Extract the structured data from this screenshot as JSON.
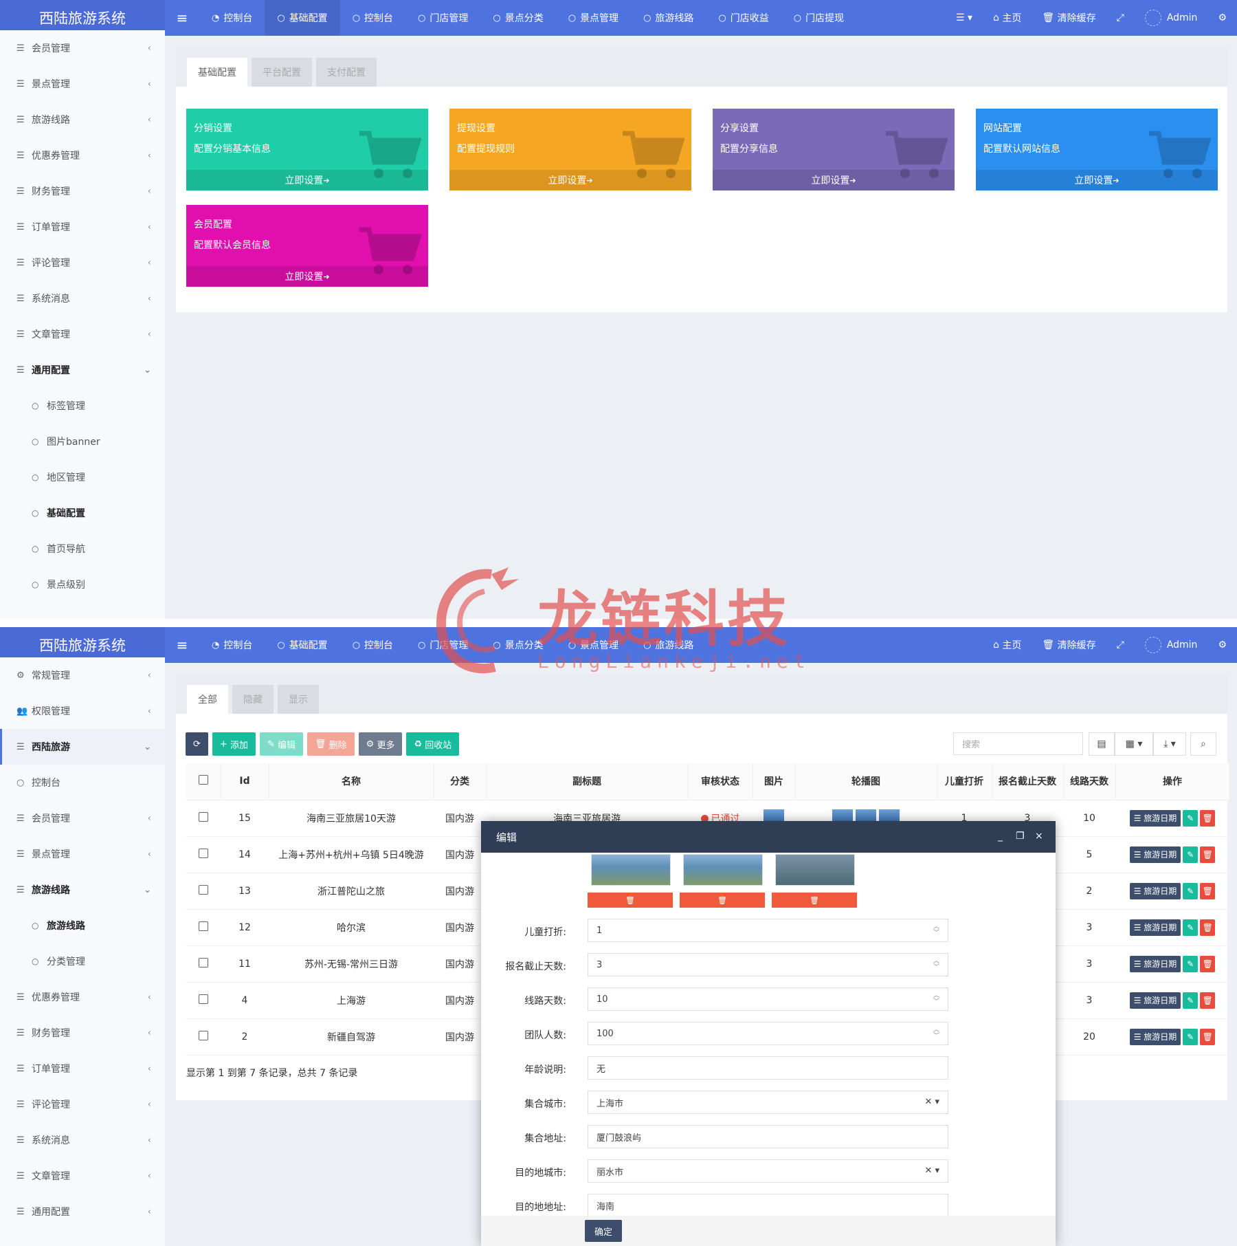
{
  "panel1": {
    "app_title": "西陆旅游系统",
    "topnav": [
      {
        "icon": "dashboard-icon",
        "label": "控制台"
      },
      {
        "icon": "circle-icon",
        "label": "基础配置"
      },
      {
        "icon": "circle-icon",
        "label": "控制台"
      },
      {
        "icon": "circle-icon",
        "label": "门店管理"
      },
      {
        "icon": "circle-icon",
        "label": "景点分类"
      },
      {
        "icon": "circle-icon",
        "label": "景点管理"
      },
      {
        "icon": "circle-icon",
        "label": "旅游线路"
      },
      {
        "icon": "circle-icon",
        "label": "门店收益"
      },
      {
        "icon": "circle-icon",
        "label": "门店提现"
      }
    ],
    "topright": {
      "home": "主页",
      "clear_cache": "清除缓存",
      "user": "Admin"
    },
    "sidebar": [
      {
        "label": "会员管理"
      },
      {
        "label": "景点管理"
      },
      {
        "label": "旅游线路"
      },
      {
        "label": "优惠券管理"
      },
      {
        "label": "财务管理"
      },
      {
        "label": "订单管理"
      },
      {
        "label": "评论管理"
      },
      {
        "label": "系统消息"
      },
      {
        "label": "文章管理"
      },
      {
        "label": "通用配置"
      }
    ],
    "sidebar_sub": [
      {
        "label": "标签管理"
      },
      {
        "label": "图片banner"
      },
      {
        "label": "地区管理"
      },
      {
        "label": "基础配置"
      },
      {
        "label": "首页导航"
      },
      {
        "label": "景点级别"
      }
    ],
    "tabs": [
      "基础配置",
      "平台配置",
      "支付配置"
    ],
    "cards": [
      {
        "title": "分销设置",
        "desc": "配置分销基本信息",
        "link": "立即设置",
        "color": "#1fcda8"
      },
      {
        "title": "提现设置",
        "desc": "配置提现规则",
        "link": "立即设置",
        "color": "#f5a623"
      },
      {
        "title": "分享设置",
        "desc": "配置分享信息",
        "link": "立即设置",
        "color": "#7b6ab8"
      },
      {
        "title": "网站配置",
        "desc": "配置默认网站信息",
        "link": "立即设置",
        "color": "#2b8ff0"
      },
      {
        "title": "会员配置",
        "desc": "配置默认会员信息",
        "link": "立即设置",
        "color": "#e00fae"
      }
    ]
  },
  "panel2": {
    "app_title": "西陆旅游系统",
    "topnav": [
      {
        "icon": "dashboard-icon",
        "label": "控制台"
      },
      {
        "icon": "circle-icon",
        "label": "基础配置"
      },
      {
        "icon": "circle-icon",
        "label": "控制台"
      },
      {
        "icon": "circle-icon",
        "label": "门店管理"
      },
      {
        "icon": "circle-icon",
        "label": "景点分类"
      },
      {
        "icon": "circle-icon",
        "label": "景点管理"
      },
      {
        "icon": "circle-icon",
        "label": "旅游线路"
      }
    ],
    "topright": {
      "home": "主页",
      "clear_cache": "清除缓存",
      "user": "Admin"
    },
    "sidebar": [
      {
        "label": "常规管理"
      },
      {
        "label": "权限管理"
      },
      {
        "label": "西陆旅游"
      },
      {
        "label": "控制台"
      },
      {
        "label": "会员管理"
      },
      {
        "label": "景点管理"
      },
      {
        "label": "旅游线路"
      },
      {
        "label": "旅游线路"
      },
      {
        "label": "分类管理"
      },
      {
        "label": "优惠券管理"
      },
      {
        "label": "财务管理"
      },
      {
        "label": "订单管理"
      },
      {
        "label": "评论管理"
      },
      {
        "label": "系统消息"
      },
      {
        "label": "文章管理"
      },
      {
        "label": "通用配置"
      }
    ],
    "tabs": [
      "全部",
      "隐藏",
      "显示"
    ],
    "toolbar": {
      "add": "添加",
      "edit": "编辑",
      "delete": "删除",
      "more": "更多",
      "recycle": "回收站"
    },
    "search_placeholder": "搜索",
    "columns": [
      "Id",
      "名称",
      "分类",
      "副标题",
      "审核状态",
      "图片",
      "轮播图",
      "儿童打折",
      "报名截止天数",
      "线路天数",
      "操作"
    ],
    "rows": [
      {
        "id": "15",
        "name": "海南三亚旅居10天游",
        "category": "国内游",
        "subtitle": "海南三亚旅居游",
        "status": "已通过",
        "child_discount": "1",
        "deadline": "3",
        "days": "10"
      },
      {
        "id": "14",
        "name": "上海+苏州+杭州+乌镇 5日4晚游",
        "category": "国内游",
        "days": "5"
      },
      {
        "id": "13",
        "name": "浙江普陀山之旅",
        "category": "国内游",
        "days": "2"
      },
      {
        "id": "12",
        "name": "哈尔滨",
        "category": "国内游",
        "days": "3"
      },
      {
        "id": "11",
        "name": "苏州-无锡-常州三日游",
        "category": "国内游",
        "days": "3"
      },
      {
        "id": "4",
        "name": "上海游",
        "category": "国内游",
        "days": "3"
      },
      {
        "id": "2",
        "name": "新疆自驾游",
        "category": "国内游",
        "days": "20"
      }
    ],
    "row_action_label": "旅游日期",
    "pagination": "显示第 1 到第 7 条记录，总共 7 条记录",
    "modal": {
      "title": "编辑",
      "fields": [
        {
          "label": "儿童打折:",
          "value": "1",
          "type": "number"
        },
        {
          "label": "报名截止天数:",
          "value": "3",
          "type": "number"
        },
        {
          "label": "线路天数:",
          "value": "10",
          "type": "number"
        },
        {
          "label": "团队人数:",
          "value": "100",
          "type": "number"
        },
        {
          "label": "年龄说明:",
          "value": "无",
          "type": "text"
        },
        {
          "label": "集合城市:",
          "value": "上海市",
          "type": "select"
        },
        {
          "label": "集合地址:",
          "value": "厦门鼓浪屿",
          "type": "text"
        },
        {
          "label": "目的地城市:",
          "value": "丽水市",
          "type": "select"
        },
        {
          "label": "目的地地址:",
          "value": "海南",
          "type": "text"
        }
      ],
      "confirm": "确定"
    }
  },
  "watermark": {
    "text": "龙链科技",
    "url": "LongLiankeji.net"
  },
  "colors": {
    "topbar": "#4e73df",
    "teal": "#18bc9c",
    "dark": "#3c4e6b",
    "red": "#e74c3c"
  }
}
